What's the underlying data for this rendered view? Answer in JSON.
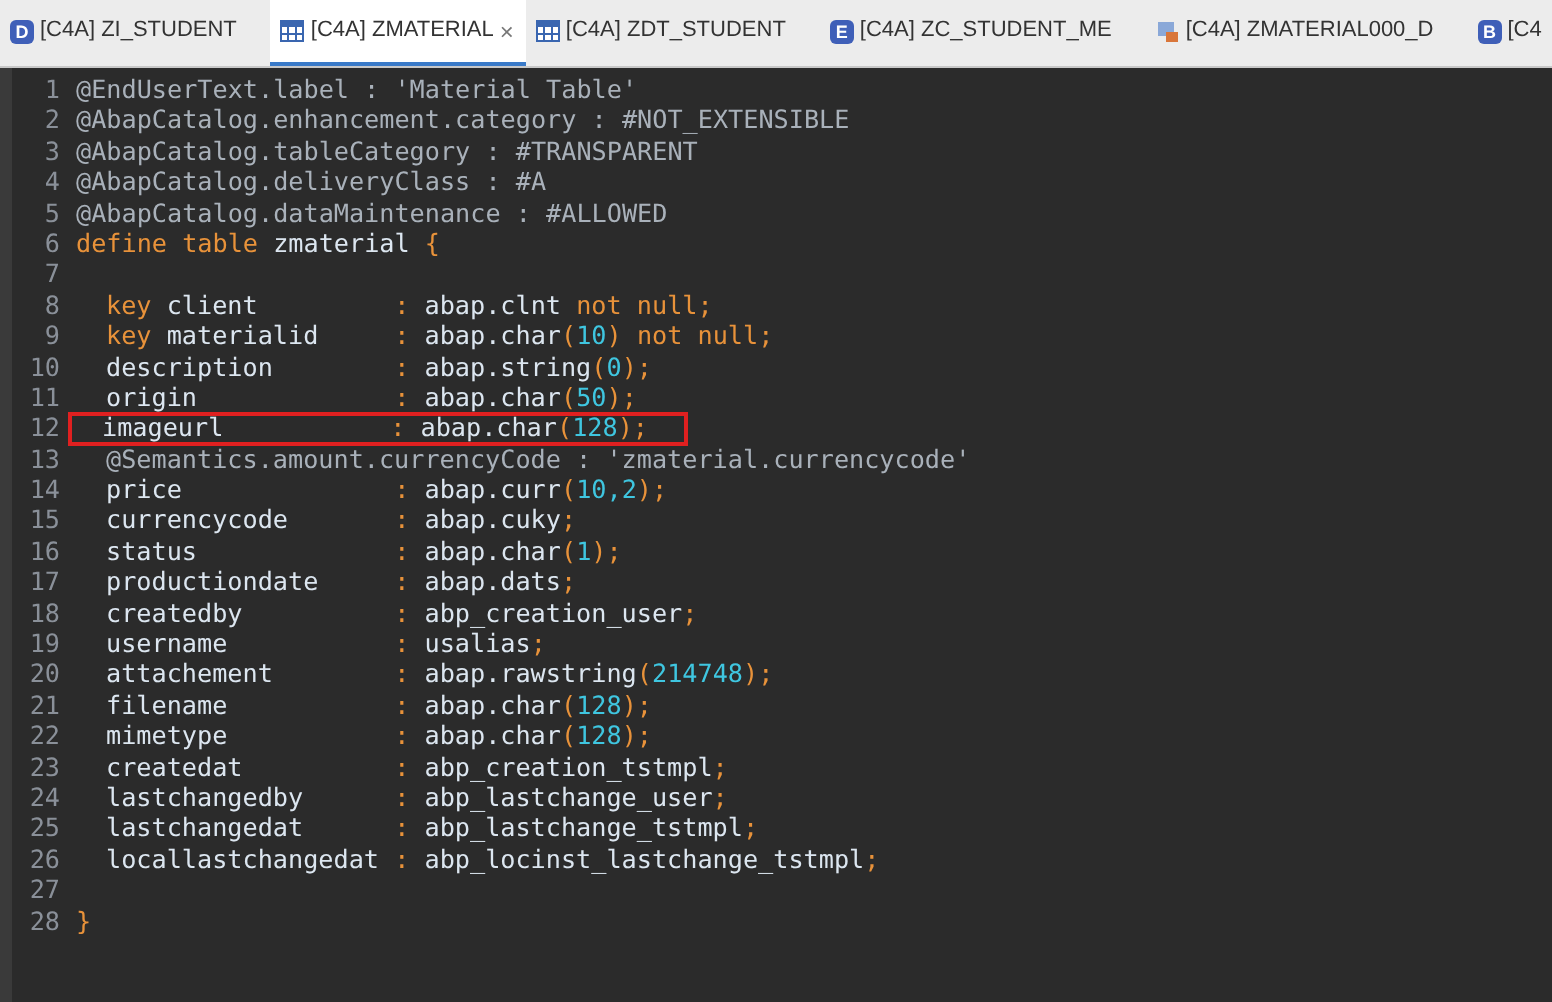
{
  "tabs": [
    {
      "label": "[C4A] ZI_STUDENT",
      "kind": "letter",
      "icon_letter": "D",
      "selected": false
    },
    {
      "label": "[C4A] ZMATERIAL",
      "kind": "table",
      "selected": true,
      "close": "×"
    },
    {
      "label": "[C4A] ZDT_STUDENT",
      "kind": "table",
      "selected": false
    },
    {
      "label": "[C4A] ZC_STUDENT_ME",
      "kind": "letter",
      "icon_letter": "E",
      "selected": false
    },
    {
      "label": "[C4A] ZMATERIAL000_D",
      "kind": "object",
      "selected": false
    },
    {
      "label": "[C4",
      "kind": "letter",
      "icon_letter": "B",
      "selected": false
    }
  ],
  "editor": {
    "lines": [
      {
        "number": "1",
        "indent": false,
        "highlighted": false,
        "tokens": [
          {
            "kind": "annotation",
            "text": "@EndUserText.label : 'Material Table'"
          }
        ]
      },
      {
        "number": "2",
        "indent": false,
        "highlighted": false,
        "tokens": [
          {
            "kind": "annotation",
            "text": "@AbapCatalog.enhancement.category : #NOT_EXTENSIBLE"
          }
        ]
      },
      {
        "number": "3",
        "indent": false,
        "highlighted": false,
        "tokens": [
          {
            "kind": "annotation",
            "text": "@AbapCatalog.tableCategory : #TRANSPARENT"
          }
        ]
      },
      {
        "number": "4",
        "indent": false,
        "highlighted": false,
        "tokens": [
          {
            "kind": "annotation",
            "text": "@AbapCatalog.deliveryClass : #A"
          }
        ]
      },
      {
        "number": "5",
        "indent": false,
        "highlighted": false,
        "tokens": [
          {
            "kind": "annotation",
            "text": "@AbapCatalog.dataMaintenance : #ALLOWED"
          }
        ]
      },
      {
        "number": "6",
        "indent": false,
        "highlighted": false,
        "tokens": [
          {
            "kind": "keyword",
            "text": "define table "
          },
          {
            "kind": "plain",
            "text": "zmaterial "
          },
          {
            "kind": "punct",
            "text": "{"
          }
        ]
      },
      {
        "number": "7",
        "highlighted": false
      },
      {
        "number": "8",
        "indent": true,
        "highlighted": false,
        "tokens": [
          {
            "kind": "keyword",
            "text": "key "
          },
          {
            "kind": "plain",
            "text": "client         "
          },
          {
            "kind": "punct",
            "text": ": "
          },
          {
            "kind": "plain",
            "text": "abap.clnt "
          },
          {
            "kind": "keyword",
            "text": "not null"
          },
          {
            "kind": "punct",
            "text": ";"
          }
        ]
      },
      {
        "number": "9",
        "indent": true,
        "highlighted": false,
        "tokens": [
          {
            "kind": "keyword",
            "text": "key "
          },
          {
            "kind": "plain",
            "text": "materialid     "
          },
          {
            "kind": "punct",
            "text": ": "
          },
          {
            "kind": "plain",
            "text": "abap.char"
          },
          {
            "kind": "punct",
            "text": "("
          },
          {
            "kind": "number",
            "text": "10"
          },
          {
            "kind": "punct",
            "text": ") "
          },
          {
            "kind": "keyword",
            "text": "not null"
          },
          {
            "kind": "punct",
            "text": ";"
          }
        ]
      },
      {
        "number": "10",
        "indent": true,
        "highlighted": false,
        "tokens": [
          {
            "kind": "plain",
            "text": "description        "
          },
          {
            "kind": "punct",
            "text": ": "
          },
          {
            "kind": "plain",
            "text": "abap.string"
          },
          {
            "kind": "punct",
            "text": "("
          },
          {
            "kind": "number",
            "text": "0"
          },
          {
            "kind": "punct",
            "text": ");"
          }
        ]
      },
      {
        "number": "11",
        "indent": true,
        "highlighted": false,
        "tokens": [
          {
            "kind": "plain",
            "text": "origin             "
          },
          {
            "kind": "punct",
            "text": ": "
          },
          {
            "kind": "plain",
            "text": "abap.char"
          },
          {
            "kind": "punct",
            "text": "("
          },
          {
            "kind": "number",
            "text": "50"
          },
          {
            "kind": "punct",
            "text": ");"
          }
        ]
      },
      {
        "number": "12",
        "indent": true,
        "highlighted": true,
        "tokens": [
          {
            "kind": "plain",
            "text": "imageurl           "
          },
          {
            "kind": "punct",
            "text": ": "
          },
          {
            "kind": "plain",
            "text": "abap.char"
          },
          {
            "kind": "punct",
            "text": "("
          },
          {
            "kind": "number",
            "text": "128"
          },
          {
            "kind": "punct",
            "text": ");"
          }
        ]
      },
      {
        "number": "13",
        "indent": true,
        "highlighted": false,
        "tokens": [
          {
            "kind": "annotation",
            "text": "@Semantics.amount.currencyCode : 'zmaterial.currencycode'"
          }
        ]
      },
      {
        "number": "14",
        "indent": true,
        "highlighted": false,
        "tokens": [
          {
            "kind": "plain",
            "text": "price              "
          },
          {
            "kind": "punct",
            "text": ": "
          },
          {
            "kind": "plain",
            "text": "abap.curr"
          },
          {
            "kind": "punct",
            "text": "("
          },
          {
            "kind": "number",
            "text": "10,2"
          },
          {
            "kind": "punct",
            "text": ");"
          }
        ]
      },
      {
        "number": "15",
        "indent": true,
        "highlighted": false,
        "tokens": [
          {
            "kind": "plain",
            "text": "currencycode       "
          },
          {
            "kind": "punct",
            "text": ": "
          },
          {
            "kind": "plain",
            "text": "abap.cuky"
          },
          {
            "kind": "punct",
            "text": ";"
          }
        ]
      },
      {
        "number": "16",
        "indent": true,
        "highlighted": false,
        "tokens": [
          {
            "kind": "plain",
            "text": "status             "
          },
          {
            "kind": "punct",
            "text": ": "
          },
          {
            "kind": "plain",
            "text": "abap.char"
          },
          {
            "kind": "punct",
            "text": "("
          },
          {
            "kind": "number",
            "text": "1"
          },
          {
            "kind": "punct",
            "text": ");"
          }
        ]
      },
      {
        "number": "17",
        "indent": true,
        "highlighted": false,
        "tokens": [
          {
            "kind": "plain",
            "text": "productiondate     "
          },
          {
            "kind": "punct",
            "text": ": "
          },
          {
            "kind": "plain",
            "text": "abap.dats"
          },
          {
            "kind": "punct",
            "text": ";"
          }
        ]
      },
      {
        "number": "18",
        "indent": true,
        "highlighted": false,
        "tokens": [
          {
            "kind": "plain",
            "text": "createdby          "
          },
          {
            "kind": "punct",
            "text": ": "
          },
          {
            "kind": "plain",
            "text": "abp_creation_user"
          },
          {
            "kind": "punct",
            "text": ";"
          }
        ]
      },
      {
        "number": "19",
        "indent": true,
        "highlighted": false,
        "tokens": [
          {
            "kind": "plain",
            "text": "username           "
          },
          {
            "kind": "punct",
            "text": ": "
          },
          {
            "kind": "plain",
            "text": "usalias"
          },
          {
            "kind": "punct",
            "text": ";"
          }
        ]
      },
      {
        "number": "20",
        "indent": true,
        "highlighted": false,
        "tokens": [
          {
            "kind": "plain",
            "text": "attachement        "
          },
          {
            "kind": "punct",
            "text": ": "
          },
          {
            "kind": "plain",
            "text": "abap.rawstring"
          },
          {
            "kind": "punct",
            "text": "("
          },
          {
            "kind": "number",
            "text": "214748"
          },
          {
            "kind": "punct",
            "text": ");"
          }
        ]
      },
      {
        "number": "21",
        "indent": true,
        "highlighted": false,
        "tokens": [
          {
            "kind": "plain",
            "text": "filename           "
          },
          {
            "kind": "punct",
            "text": ": "
          },
          {
            "kind": "plain",
            "text": "abap.char"
          },
          {
            "kind": "punct",
            "text": "("
          },
          {
            "kind": "number",
            "text": "128"
          },
          {
            "kind": "punct",
            "text": ");"
          }
        ]
      },
      {
        "number": "22",
        "indent": true,
        "highlighted": false,
        "tokens": [
          {
            "kind": "plain",
            "text": "mimetype           "
          },
          {
            "kind": "punct",
            "text": ": "
          },
          {
            "kind": "plain",
            "text": "abap.char"
          },
          {
            "kind": "punct",
            "text": "("
          },
          {
            "kind": "number",
            "text": "128"
          },
          {
            "kind": "punct",
            "text": ");"
          }
        ]
      },
      {
        "number": "23",
        "indent": true,
        "highlighted": false,
        "tokens": [
          {
            "kind": "plain",
            "text": "createdat          "
          },
          {
            "kind": "punct",
            "text": ": "
          },
          {
            "kind": "plain",
            "text": "abp_creation_tstmpl"
          },
          {
            "kind": "punct",
            "text": ";"
          }
        ]
      },
      {
        "number": "24",
        "indent": true,
        "highlighted": false,
        "tokens": [
          {
            "kind": "plain",
            "text": "lastchangedby      "
          },
          {
            "kind": "punct",
            "text": ": "
          },
          {
            "kind": "plain",
            "text": "abp_lastchange_user"
          },
          {
            "kind": "punct",
            "text": ";"
          }
        ]
      },
      {
        "number": "25",
        "indent": true,
        "highlighted": false,
        "tokens": [
          {
            "kind": "plain",
            "text": "lastchangedat      "
          },
          {
            "kind": "punct",
            "text": ": "
          },
          {
            "kind": "plain",
            "text": "abp_lastchange_tstmpl"
          },
          {
            "kind": "punct",
            "text": ";"
          }
        ]
      },
      {
        "number": "26",
        "indent": true,
        "highlighted": false,
        "tokens": [
          {
            "kind": "plain",
            "text": "locallastchangedat "
          },
          {
            "kind": "punct",
            "text": ": "
          },
          {
            "kind": "plain",
            "text": "abp_locinst_lastchange_tstmpl"
          },
          {
            "kind": "punct",
            "text": ";"
          }
        ]
      },
      {
        "number": "27",
        "highlighted": false
      },
      {
        "number": "28",
        "indent": false,
        "highlighted": false,
        "tokens": [
          {
            "kind": "punct",
            "text": "}"
          }
        ]
      }
    ]
  }
}
